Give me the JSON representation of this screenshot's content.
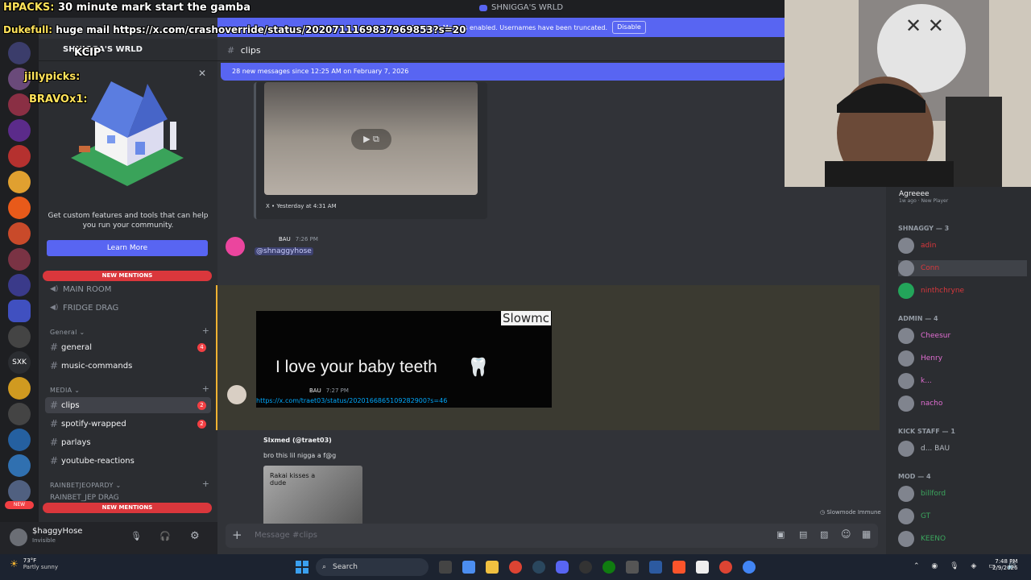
{
  "window": {
    "title": "SHNIGGA'S WRLD"
  },
  "streamer_mode": {
    "text": "Streamer Mode is enabled. Usernames have been truncated.",
    "button": "Disable"
  },
  "overlay_chat": [
    {
      "user": "HPACKS:",
      "text": "30 minute mark start the gamba",
      "user_color": "#ffe35a"
    },
    {
      "user": "Dukefull:",
      "text": "huge mail https://x.com/crashoverride/status/2020711169837969853?s=20",
      "user_color": "#ffe35a"
    },
    {
      "user": "",
      "text": "KCIP",
      "user_color": "#ff4040"
    },
    {
      "user": "jillypicks:",
      "text": "",
      "user_color": "#ffe35a"
    },
    {
      "user": "BRAVOx1:",
      "text": "",
      "user_color": "#ffe35a"
    }
  ],
  "server": {
    "name": "SHNIGGA'S WRLD"
  },
  "promo": {
    "text": "Get custom features and tools that can help you run your community.",
    "button": "Learn More"
  },
  "new_mentions": "NEW MENTIONS",
  "channels": {
    "voice": [
      {
        "label": "MAIN ROOM"
      },
      {
        "label": "FRIDGE DRAG"
      }
    ],
    "categories": [
      {
        "name": "General",
        "items": [
          {
            "label": "general",
            "badge": "4"
          },
          {
            "label": "music-commands",
            "badge": ""
          }
        ]
      },
      {
        "name": "MEDIA",
        "items": [
          {
            "label": "clips",
            "badge": "2"
          },
          {
            "label": "spotify-wrapped",
            "badge": "2"
          },
          {
            "label": "parlays",
            "badge": ""
          },
          {
            "label": "youtube-reactions",
            "badge": ""
          }
        ]
      },
      {
        "name": "RAINBETJEOPARDY",
        "items": [
          {
            "label": "RAINBET_JEP DRAG",
            "badge": ""
          }
        ]
      }
    ]
  },
  "user": {
    "name": "$haggyHose",
    "status": "Invisible"
  },
  "channel": {
    "name": "clips"
  },
  "new_messages_bar": "28 new messages since 12:25 AM on February 7, 2026",
  "messages": [
    {
      "source": "X",
      "time": "Yesterday at 4:31 AM"
    },
    {
      "author": "BAU",
      "time": "7:26 PM",
      "mention": "@shnaggyhose"
    },
    {
      "author": "BAU",
      "time": "7:27 PM",
      "link": "https://x.com/traet03/status/2020166865109282900?s=46",
      "embed_title": "Slxmed (@traet03)",
      "embed_text": "bro this lil nigga a f@g",
      "thumb_caption": "Rakai kisses a dude"
    },
    {
      "video_caption": "I love your baby teeth",
      "video_corner": "Slowmc"
    }
  ],
  "slowmode": "Slowmode Immune",
  "input": {
    "placeholder": "Message #clips"
  },
  "members": {
    "top_user": {
      "name": "Agreeee",
      "sub": "1w ago",
      "status": "New Player"
    },
    "groups": [
      {
        "name": "SHNAGGY — 3",
        "members": [
          "adin",
          "Conn",
          "ninthchryne"
        ]
      },
      {
        "name": "ADMIN — 4",
        "members": [
          "Cheesur",
          "Henry",
          "k...",
          "nacho"
        ]
      },
      {
        "name": "KICK STAFF — 1",
        "members": [
          "d... BAU"
        ]
      },
      {
        "name": "MOD — 4",
        "members": [
          "billford",
          "GT",
          "KEENO"
        ]
      }
    ]
  },
  "taskbar": {
    "weather_temp": "73°F",
    "weather_desc": "Partly sunny",
    "search": "Search",
    "time": "7:48 PM",
    "date": "2/9/2026"
  },
  "colors": {
    "blurple": "#5865f2",
    "red": "#da373c",
    "bg": "#313338",
    "sidebar": "#2b2d31"
  }
}
